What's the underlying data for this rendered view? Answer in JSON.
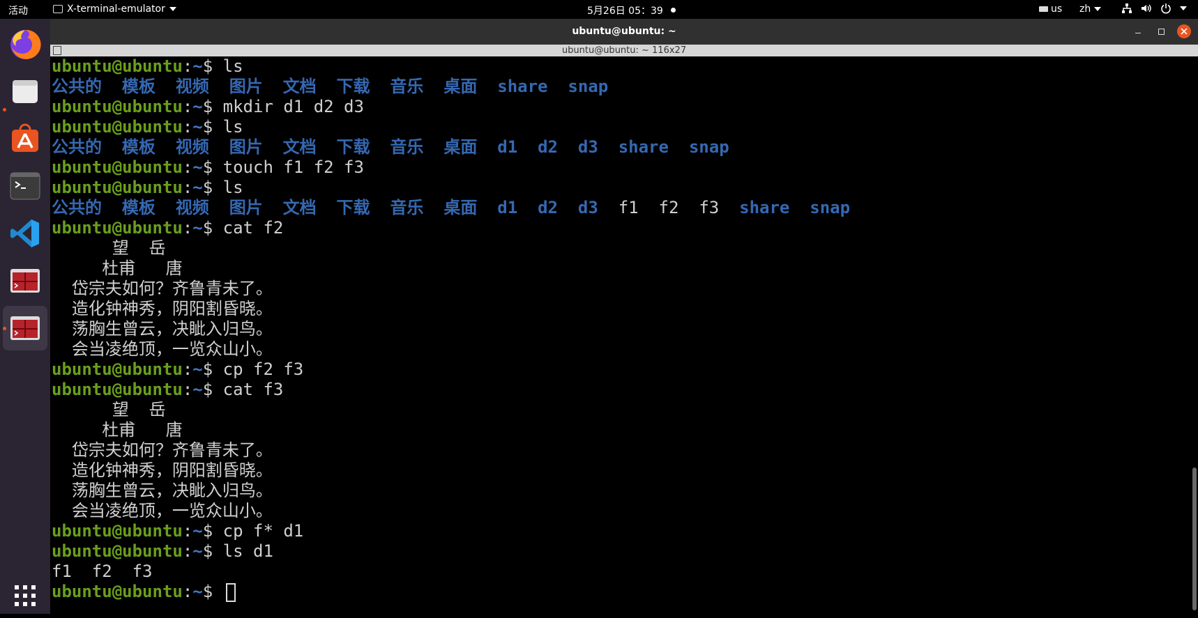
{
  "topbar": {
    "activities": "活动",
    "app_name": "X-terminal-emulator",
    "clock": "5月26日  05：39",
    "keyboard": "us",
    "input_method": "zh"
  },
  "dock": {
    "items": [
      {
        "name": "firefox",
        "running": false,
        "active": false
      },
      {
        "name": "files",
        "running": true,
        "active": false
      },
      {
        "name": "ubuntu-software",
        "running": false,
        "active": false
      },
      {
        "name": "terminal",
        "running": false,
        "active": false
      },
      {
        "name": "vscode",
        "running": false,
        "active": false
      },
      {
        "name": "red-app",
        "running": false,
        "active": false
      },
      {
        "name": "red-app",
        "running": true,
        "active": true
      }
    ]
  },
  "window": {
    "title": "ubuntu@ubuntu: ~",
    "subtitle": "ubuntu@ubuntu: ~ 116x27"
  },
  "colors": {
    "prompt_user": "#6a9f1c",
    "prompt_path": "#3c78c8",
    "directory": "#3568b2",
    "accent": "#e95420"
  },
  "terminal": {
    "prompt_user": "ubuntu@ubuntu",
    "prompt_sep": ":",
    "prompt_path": "~",
    "prompt_dollar": "$",
    "lines": [
      {
        "type": "prompt",
        "cmd": "ls"
      },
      {
        "type": "list",
        "items": [
          {
            "t": "公共的",
            "k": "dir"
          },
          {
            "t": "模板",
            "k": "dir"
          },
          {
            "t": "视频",
            "k": "dir"
          },
          {
            "t": "图片",
            "k": "dir"
          },
          {
            "t": "文档",
            "k": "dir"
          },
          {
            "t": "下载",
            "k": "dir"
          },
          {
            "t": "音乐",
            "k": "dir"
          },
          {
            "t": "桌面",
            "k": "dir"
          },
          {
            "t": "share",
            "k": "dir"
          },
          {
            "t": "snap",
            "k": "dir"
          }
        ]
      },
      {
        "type": "prompt",
        "cmd": "mkdir d1 d2 d3"
      },
      {
        "type": "prompt",
        "cmd": "ls"
      },
      {
        "type": "list",
        "items": [
          {
            "t": "公共的",
            "k": "dir"
          },
          {
            "t": "模板",
            "k": "dir"
          },
          {
            "t": "视频",
            "k": "dir"
          },
          {
            "t": "图片",
            "k": "dir"
          },
          {
            "t": "文档",
            "k": "dir"
          },
          {
            "t": "下载",
            "k": "dir"
          },
          {
            "t": "音乐",
            "k": "dir"
          },
          {
            "t": "桌面",
            "k": "dir"
          },
          {
            "t": "d1",
            "k": "dir"
          },
          {
            "t": "d2",
            "k": "dir"
          },
          {
            "t": "d3",
            "k": "dir"
          },
          {
            "t": "share",
            "k": "dir"
          },
          {
            "t": "snap",
            "k": "dir"
          }
        ]
      },
      {
        "type": "prompt",
        "cmd": "touch f1 f2 f3"
      },
      {
        "type": "prompt",
        "cmd": "ls"
      },
      {
        "type": "list",
        "items": [
          {
            "t": "公共的",
            "k": "dir"
          },
          {
            "t": "模板",
            "k": "dir"
          },
          {
            "t": "视频",
            "k": "dir"
          },
          {
            "t": "图片",
            "k": "dir"
          },
          {
            "t": "文档",
            "k": "dir"
          },
          {
            "t": "下载",
            "k": "dir"
          },
          {
            "t": "音乐",
            "k": "dir"
          },
          {
            "t": "桌面",
            "k": "dir"
          },
          {
            "t": "d1",
            "k": "dir"
          },
          {
            "t": "d2",
            "k": "dir"
          },
          {
            "t": "d3",
            "k": "dir"
          },
          {
            "t": "f1",
            "k": "file"
          },
          {
            "t": "f2",
            "k": "file"
          },
          {
            "t": "f3",
            "k": "file"
          },
          {
            "t": "share",
            "k": "dir"
          },
          {
            "t": "snap",
            "k": "dir"
          }
        ]
      },
      {
        "type": "prompt",
        "cmd": "cat f2"
      },
      {
        "type": "text",
        "text": "      望  岳"
      },
      {
        "type": "text",
        "text": "     杜甫   唐"
      },
      {
        "type": "text",
        "text": "  岱宗夫如何？齐鲁青未了。"
      },
      {
        "type": "text",
        "text": "  造化钟神秀，阴阳割昏晓。"
      },
      {
        "type": "text",
        "text": "  荡胸生曾云，决眦入归鸟。"
      },
      {
        "type": "text",
        "text": "  会当凌绝顶，一览众山小。"
      },
      {
        "type": "prompt",
        "cmd": "cp f2 f3"
      },
      {
        "type": "prompt",
        "cmd": "cat f3"
      },
      {
        "type": "text",
        "text": "      望  岳"
      },
      {
        "type": "text",
        "text": "     杜甫   唐"
      },
      {
        "type": "text",
        "text": "  岱宗夫如何？齐鲁青未了。"
      },
      {
        "type": "text",
        "text": "  造化钟神秀，阴阳割昏晓。"
      },
      {
        "type": "text",
        "text": "  荡胸生曾云，决眦入归鸟。"
      },
      {
        "type": "text",
        "text": "  会当凌绝顶，一览众山小。"
      },
      {
        "type": "prompt",
        "cmd": "cp f* d1"
      },
      {
        "type": "prompt",
        "cmd": "ls d1"
      },
      {
        "type": "text",
        "text": "f1  f2  f3"
      },
      {
        "type": "prompt",
        "cmd": "",
        "cursor": true
      }
    ]
  }
}
